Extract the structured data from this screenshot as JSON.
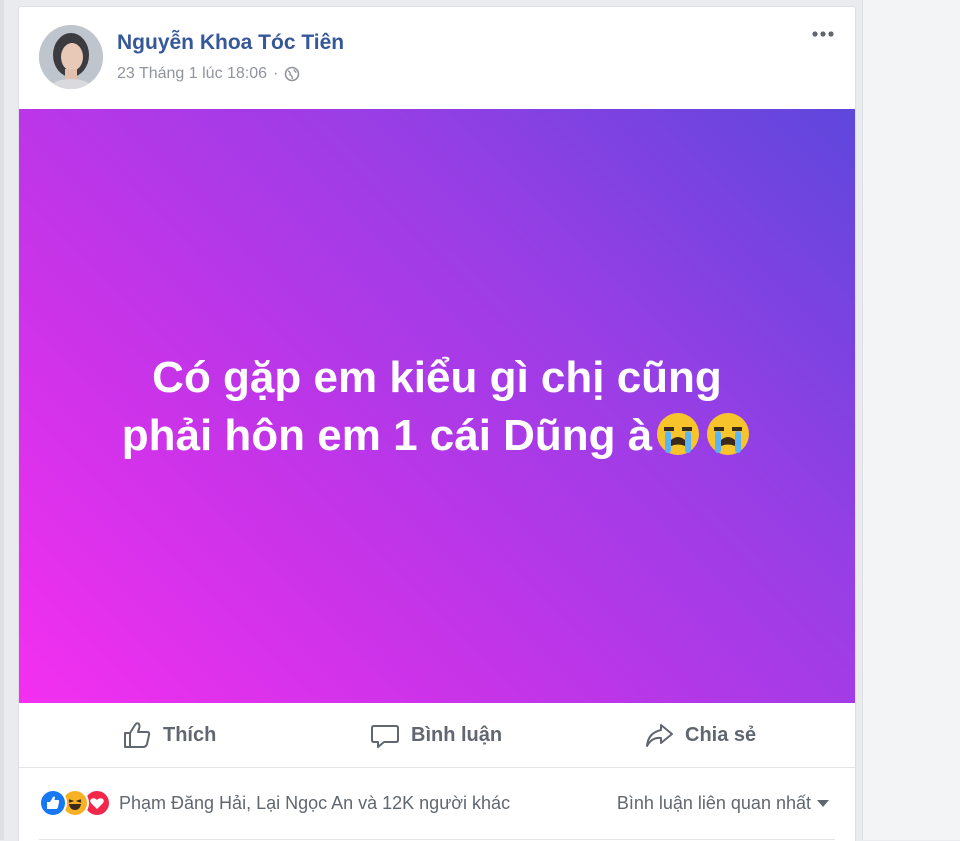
{
  "post": {
    "author": "Nguyễn Khoa Tóc Tiên",
    "timestamp": "23 Tháng 1 lúc 18:06",
    "separator": "·",
    "privacy_icon": "globe-icon",
    "more_icon": "more-options-icon",
    "text_line1": "Có gặp em kiểu gì chị cũng",
    "text_line2": "phải hôn em 1 cái Dũng à",
    "text_emoji": "loudly-crying-face-emoji",
    "background_gradient": [
      "#f42ff0",
      "#c434e8",
      "#9a3ee6",
      "#5e47dc"
    ]
  },
  "actions": {
    "like_label": "Thích",
    "comment_label": "Bình luận",
    "share_label": "Chia sẻ"
  },
  "reactions": {
    "icons": [
      "like-reaction-icon",
      "haha-reaction-icon",
      "love-reaction-icon"
    ],
    "summary": "Phạm Đăng Hải, Lại Ngọc An và 12K người khác"
  },
  "comments": {
    "sort_label": "Bình luận liên quan nhất"
  },
  "colors": {
    "link_blue": "#365899",
    "meta_gray": "#90949c",
    "action_gray": "#606770"
  }
}
